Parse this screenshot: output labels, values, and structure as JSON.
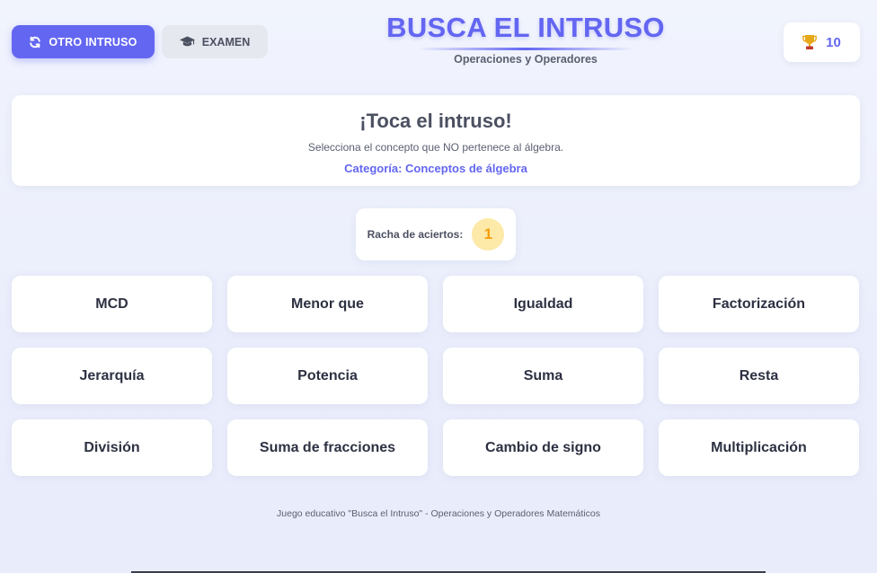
{
  "header": {
    "other_button_label": "OTRO INTRUSO",
    "exam_button_label": "EXAMEN",
    "title": "BUSCA EL INTRUSO",
    "subtitle": "Operaciones y Operadores",
    "score": "10"
  },
  "instruction": {
    "title": "¡Toca el intruso!",
    "description": "Selecciona el concepto que NO pertenece al álgebra.",
    "category": "Categoría: Conceptos de álgebra"
  },
  "streak": {
    "label": "Racha de aciertos:",
    "count": "1"
  },
  "options": [
    {
      "label": "MCD"
    },
    {
      "label": "Menor que"
    },
    {
      "label": "Igualdad"
    },
    {
      "label": "Factorización"
    },
    {
      "label": "Jerarquía"
    },
    {
      "label": "Potencia"
    },
    {
      "label": "Suma"
    },
    {
      "label": "Resta"
    },
    {
      "label": "División"
    },
    {
      "label": "Suma de fracciones"
    },
    {
      "label": "Cambio de signo"
    },
    {
      "label": "Multiplicación"
    }
  ],
  "footer": "Juego educativo \"Busca el Intruso\" - Operaciones y Operadores Matemáticos",
  "icons": {
    "other_button": "refresh-icon",
    "exam_button": "graduation-cap-icon",
    "score": "trophy-icon"
  },
  "colors": {
    "accent": "#6366f1",
    "streak_badge_bg": "#fde9a8",
    "streak_badge_text": "#f59e0b",
    "trophy": "#e6a817"
  }
}
